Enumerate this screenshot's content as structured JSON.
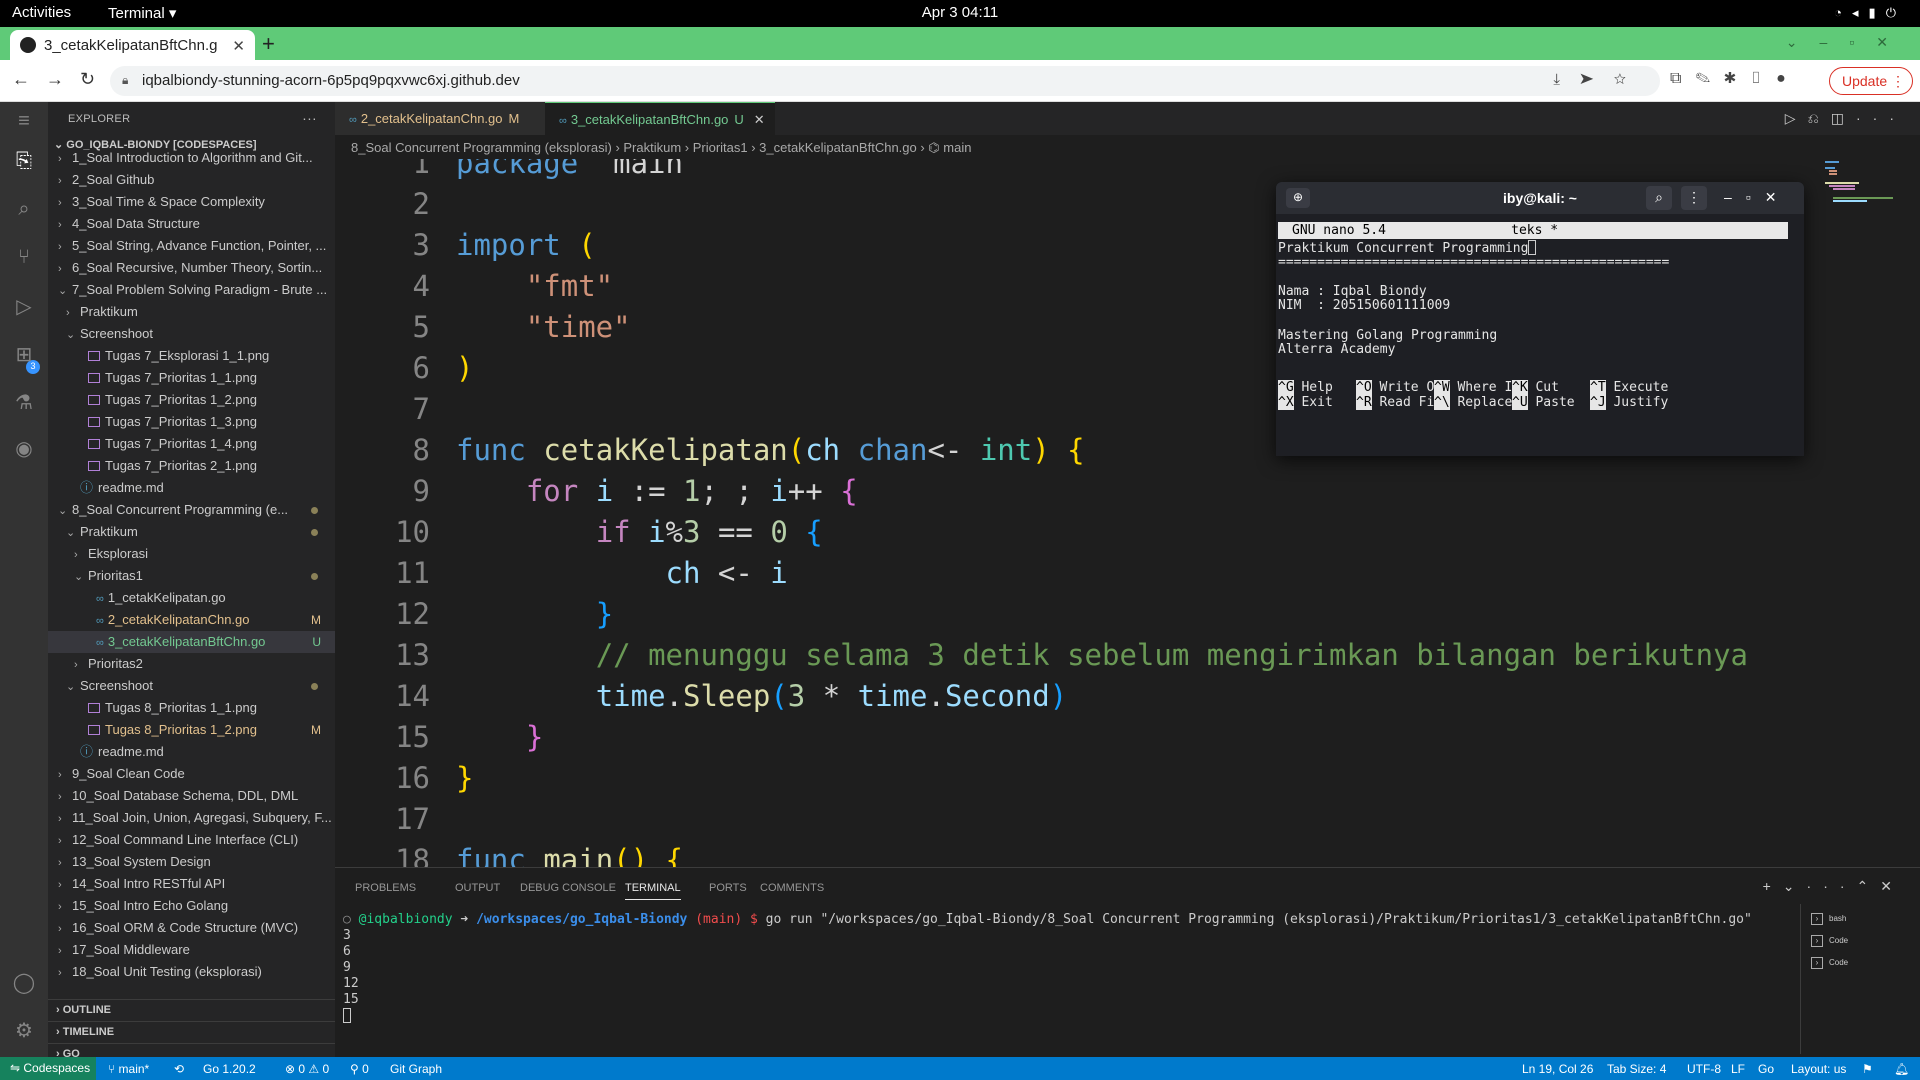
{
  "gnome": {
    "activities": "Activities",
    "app": "Terminal ▾",
    "clock": "Apr 3  04:11"
  },
  "browser": {
    "tab_title": "3_cetakKelipatanBftChn.g",
    "url": "iqbalbiondy-stunning-acorn-6p5pq9pqxvwc6xj.github.dev",
    "update_label": "Update"
  },
  "explorer": {
    "header": "EXPLORER",
    "root": "GO_IQBAL-BIONDY [CODESPACES]",
    "items": [
      {
        "label": "1_Soal Introduction to Algorithm and Git...",
        "indent": 0,
        "chev": "›",
        "type": "folder",
        "status": ""
      },
      {
        "label": "2_Soal Github",
        "indent": 0,
        "chev": "›",
        "type": "folder",
        "status": ""
      },
      {
        "label": "3_Soal Time & Space Complexity",
        "indent": 0,
        "chev": "›",
        "type": "folder",
        "status": ""
      },
      {
        "label": "4_Soal Data Structure",
        "indent": 0,
        "chev": "›",
        "type": "folder",
        "status": ""
      },
      {
        "label": "5_Soal String, Advance Function, Pointer, ...",
        "indent": 0,
        "chev": "›",
        "type": "folder",
        "status": ""
      },
      {
        "label": "6_Soal Recursive, Number Theory, Sortin...",
        "indent": 0,
        "chev": "›",
        "type": "folder",
        "status": ""
      },
      {
        "label": "7_Soal Problem Solving Paradigm - Brute ...",
        "indent": 0,
        "chev": "⌄",
        "type": "folder",
        "status": ""
      },
      {
        "label": "Praktikum",
        "indent": 1,
        "chev": "›",
        "type": "folder",
        "status": ""
      },
      {
        "label": "Screenshoot",
        "indent": 1,
        "chev": "⌄",
        "type": "folder",
        "status": ""
      },
      {
        "label": "Tugas 7_Eksplorasi 1_1.png",
        "indent": 2,
        "chev": "",
        "type": "img",
        "status": ""
      },
      {
        "label": "Tugas 7_Prioritas 1_1.png",
        "indent": 2,
        "chev": "",
        "type": "img",
        "status": ""
      },
      {
        "label": "Tugas 7_Prioritas 1_2.png",
        "indent": 2,
        "chev": "",
        "type": "img",
        "status": ""
      },
      {
        "label": "Tugas 7_Prioritas 1_3.png",
        "indent": 2,
        "chev": "",
        "type": "img",
        "status": ""
      },
      {
        "label": "Tugas 7_Prioritas 1_4.png",
        "indent": 2,
        "chev": "",
        "type": "img",
        "status": ""
      },
      {
        "label": "Tugas 7_Prioritas 2_1.png",
        "indent": 2,
        "chev": "",
        "type": "img",
        "status": ""
      },
      {
        "label": "readme.md",
        "indent": 1,
        "chev": "",
        "type": "info",
        "status": ""
      },
      {
        "label": "8_Soal Concurrent Programming (e...",
        "indent": 0,
        "chev": "⌄",
        "type": "folder",
        "status": "mod-dot"
      },
      {
        "label": "Praktikum",
        "indent": 1,
        "chev": "⌄",
        "type": "folder",
        "status": "mod-dot"
      },
      {
        "label": "Eksplorasi",
        "indent": 2,
        "chev": "›",
        "type": "folder",
        "status": ""
      },
      {
        "label": "Prioritas1",
        "indent": 2,
        "chev": "⌄",
        "type": "folder",
        "status": "mod-dot"
      },
      {
        "label": "1_cetakKelipatan.go",
        "indent": 3,
        "chev": "",
        "type": "go",
        "status": ""
      },
      {
        "label": "2_cetakKelipatanChn.go",
        "indent": 3,
        "chev": "",
        "type": "go",
        "status": "M"
      },
      {
        "label": "3_cetakKelipatanBftChn.go",
        "indent": 3,
        "chev": "",
        "type": "go",
        "status": "U"
      },
      {
        "label": "Prioritas2",
        "indent": 2,
        "chev": "›",
        "type": "folder",
        "status": ""
      },
      {
        "label": "Screenshoot",
        "indent": 1,
        "chev": "⌄",
        "type": "folder",
        "status": "mod-dot"
      },
      {
        "label": "Tugas 8_Prioritas 1_1.png",
        "indent": 2,
        "chev": "",
        "type": "img",
        "status": ""
      },
      {
        "label": "Tugas 8_Prioritas 1_2.png",
        "indent": 2,
        "chev": "",
        "type": "img",
        "status": "M"
      },
      {
        "label": "readme.md",
        "indent": 1,
        "chev": "",
        "type": "info",
        "status": ""
      },
      {
        "label": "9_Soal Clean Code",
        "indent": 0,
        "chev": "›",
        "type": "folder",
        "status": ""
      },
      {
        "label": "10_Soal Database Schema, DDL, DML",
        "indent": 0,
        "chev": "›",
        "type": "folder",
        "status": ""
      },
      {
        "label": "11_Soal Join, Union, Agregasi, Subquery, F...",
        "indent": 0,
        "chev": "›",
        "type": "folder",
        "status": ""
      },
      {
        "label": "12_Soal Command Line Interface (CLI)",
        "indent": 0,
        "chev": "›",
        "type": "folder",
        "status": ""
      },
      {
        "label": "13_Soal System Design",
        "indent": 0,
        "chev": "›",
        "type": "folder",
        "status": ""
      },
      {
        "label": "14_Soal Intro RESTful API",
        "indent": 0,
        "chev": "›",
        "type": "folder",
        "status": ""
      },
      {
        "label": "15_Soal Intro Echo Golang",
        "indent": 0,
        "chev": "›",
        "type": "folder",
        "status": ""
      },
      {
        "label": "16_Soal ORM & Code Structure (MVC)",
        "indent": 0,
        "chev": "›",
        "type": "folder",
        "status": ""
      },
      {
        "label": "17_Soal Middleware",
        "indent": 0,
        "chev": "›",
        "type": "folder",
        "status": ""
      },
      {
        "label": "18_Soal Unit Testing (eksplorasi)",
        "indent": 0,
        "chev": "›",
        "type": "folder",
        "status": ""
      }
    ],
    "outline": "OUTLINE",
    "timeline": "TIMELINE",
    "go": "GO"
  },
  "editor": {
    "tab1": {
      "name": "2_cetakKelipatanChn.go",
      "status": "M"
    },
    "tab2": {
      "name": "3_cetakKelipatanBftChn.go",
      "status": "U"
    },
    "breadcrumb": "8_Soal Concurrent Programming (eksplorasi)  ›  Praktikum  ›  Prioritas1  ›  3_cetakKelipatanBftChn.go  ›  ⌬ main",
    "lines": [
      [
        [
          "k",
          "package"
        ],
        [
          "",
          "  main"
        ]
      ],
      [],
      [
        [
          "k",
          "import"
        ],
        [
          "",
          ""
        ],
        [
          "p1",
          " ("
        ]
      ],
      [
        [
          "",
          "    "
        ],
        [
          "s",
          "\"fmt\""
        ]
      ],
      [
        [
          "",
          "    "
        ],
        [
          "s",
          "\"time\""
        ]
      ],
      [
        [
          "p1",
          ")"
        ]
      ],
      [],
      [
        [
          "k",
          "func"
        ],
        [
          "",
          " "
        ],
        [
          "f",
          "cetakKelipatan"
        ],
        [
          "p1",
          "("
        ],
        [
          "v",
          "ch"
        ],
        [
          "",
          " "
        ],
        [
          "k",
          "chan"
        ],
        [
          "",
          "<- "
        ],
        [
          "t",
          "int"
        ],
        [
          "p1",
          ")"
        ],
        [
          "",
          " "
        ],
        [
          "p1",
          "{"
        ]
      ],
      [
        [
          "",
          "    "
        ],
        [
          "kc",
          "for"
        ],
        [
          "",
          " "
        ],
        [
          "v",
          "i"
        ],
        [
          "",
          " := "
        ],
        [
          "n",
          "1"
        ],
        [
          "",
          "; ; "
        ],
        [
          "v",
          "i"
        ],
        [
          "",
          "++ "
        ],
        [
          "p2",
          "{"
        ]
      ],
      [
        [
          "",
          "        "
        ],
        [
          "kc",
          "if"
        ],
        [
          "",
          " "
        ],
        [
          "v",
          "i"
        ],
        [
          "",
          "%"
        ],
        [
          "n",
          "3"
        ],
        [
          "",
          " == "
        ],
        [
          "n",
          "0"
        ],
        [
          "",
          " "
        ],
        [
          "p3",
          "{"
        ]
      ],
      [
        [
          "",
          "            "
        ],
        [
          "v",
          "ch"
        ],
        [
          "",
          " <- "
        ],
        [
          "v",
          "i"
        ]
      ],
      [
        [
          "",
          "        "
        ],
        [
          "p3",
          "}"
        ]
      ],
      [
        [
          "",
          "        "
        ],
        [
          "c",
          "// menunggu selama 3 detik sebelum mengirimkan bilangan berikutnya"
        ]
      ],
      [
        [
          "",
          "        "
        ],
        [
          "v",
          "time"
        ],
        [
          "",
          "."
        ],
        [
          "f",
          "Sleep"
        ],
        [
          "p3",
          "("
        ],
        [
          "n",
          "3"
        ],
        [
          "",
          " * "
        ],
        [
          "v",
          "time"
        ],
        [
          "",
          "."
        ],
        [
          "v",
          "Second"
        ],
        [
          "p3",
          ")"
        ]
      ],
      [
        [
          "",
          "    "
        ],
        [
          "p2",
          "}"
        ]
      ],
      [
        [
          "p1",
          "}"
        ]
      ],
      [],
      [
        [
          "k",
          "func"
        ],
        [
          "",
          " "
        ],
        [
          "f",
          "main"
        ],
        [
          "p1",
          "()"
        ],
        [
          "",
          " "
        ],
        [
          "p1",
          "{"
        ]
      ]
    ]
  },
  "nano": {
    "window_title": "iby@kali: ~",
    "header": "GNU nano 5.4                teks *",
    "lines": [
      "Praktikum Concurrent Programming",
      "==================================================",
      "",
      "Nama : Iqbal Biondy",
      "NIM  : 205150601111009",
      "",
      "Mastering Golang Programming",
      "Alterra Academy"
    ],
    "keys": [
      {
        "k": "^G",
        "l": "Help"
      },
      {
        "k": "^O",
        "l": "Write Out"
      },
      {
        "k": "^W",
        "l": "Where Is"
      },
      {
        "k": "^K",
        "l": "Cut"
      },
      {
        "k": "^T",
        "l": "Execute"
      },
      {
        "k": "^X",
        "l": "Exit"
      },
      {
        "k": "^R",
        "l": "Read File"
      },
      {
        "k": "^\\",
        "l": "Replace"
      },
      {
        "k": "^U",
        "l": "Paste"
      },
      {
        "k": "^J",
        "l": "Justify"
      }
    ]
  },
  "panel": {
    "tabs": [
      "PROBLEMS",
      "OUTPUT",
      "DEBUG CONSOLE",
      "TERMINAL",
      "PORTS",
      "COMMENTS"
    ],
    "active_tab": "TERMINAL",
    "prompt_user": "@iqbalbiondy",
    "prompt_arrow": " ➜ ",
    "prompt_path": "/workspaces/go_Iqbal-Biondy",
    "prompt_branch_open": " (",
    "prompt_branch": "main",
    "prompt_branch_close": ") $ ",
    "command": "go run \"/workspaces/go_Iqbal-Biondy/8_Soal Concurrent Programming (eksplorasi)/Praktikum/Prioritas1/3_cetakKelipatanBftChn.go\"",
    "output": [
      "3",
      "6",
      "9",
      "12",
      "15"
    ],
    "terminals": [
      "bash",
      "Code",
      "Code"
    ]
  },
  "status": {
    "remote": "Codespaces",
    "branch": "main*",
    "go_version": "Go 1.20.2",
    "problems": "⊗ 0 ⚠ 0",
    "ports": "⚲ 0",
    "git_graph": "Git Graph",
    "position": "Ln 19, Col 26",
    "tab_size": "Tab Size: 4",
    "encoding": "UTF-8",
    "eol": "LF",
    "language": "Go",
    "layout": "Layout: us"
  }
}
